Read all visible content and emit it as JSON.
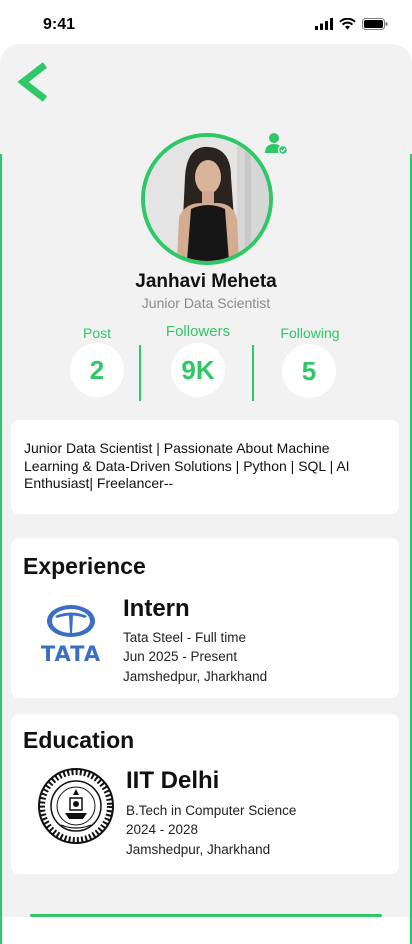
{
  "status": {
    "time": "9:41"
  },
  "profile": {
    "name": "Janhavi Meheta",
    "role": "Junior Data Scientist",
    "avatar_alt": "profile photo"
  },
  "stats": [
    {
      "label": "Post",
      "value": "2"
    },
    {
      "label": "Followers",
      "value": "9K"
    },
    {
      "label": "Following",
      "value": "5"
    }
  ],
  "bio": "Junior Data Scientist | Passionate About Machine Learning & Data-Driven Solutions | Python | SQL | AI Enthusiast| Freelancer--",
  "experience": {
    "title": "Experience",
    "role": "Intern",
    "company": "Tata Steel - Full time",
    "dates": "Jun 2025 - Present",
    "location": "Jamshedpur, Jharkhand",
    "logo_text": "TATA"
  },
  "education": {
    "title": "Education",
    "school": "IIT Delhi",
    "degree": "B.Tech in Computer Science",
    "dates": "2024 - 2028",
    "location": "Jamshedpur, Jharkhand"
  },
  "colors": {
    "accent": "#2ec866",
    "tata_blue": "#3a6fc4",
    "background": "#f2f2f2"
  },
  "icons": {
    "back": "chevron-left-icon",
    "user_settings": "user-settings-icon"
  }
}
